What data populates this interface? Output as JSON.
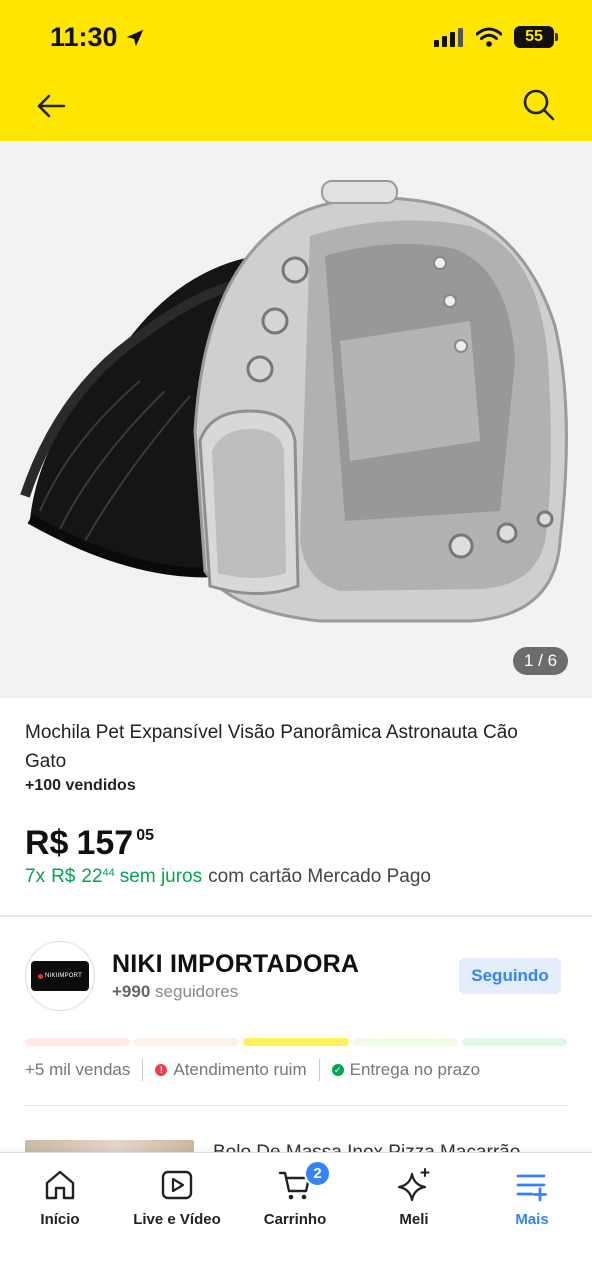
{
  "status_bar": {
    "time": "11:30",
    "battery": "55"
  },
  "gallery": {
    "counter": "1 / 6"
  },
  "product": {
    "title": "Mochila Pet Expansível Visão Panorâmica Astronauta Cão Gato",
    "sold": "+100 vendidos",
    "price_currency": "R$",
    "price_whole": "157",
    "price_cents": "05",
    "installments_count": "7x",
    "installments_currency": "R$",
    "installments_whole": "22",
    "installments_cents": "44",
    "installments_no_interest": "sem juros",
    "installments_suffix": "com cartão Mercado Pago"
  },
  "seller": {
    "name": "NIKI IMPORTADORA",
    "logo_text": "NIKIIMPORT",
    "followers_count": "+990",
    "followers_label": "seguidores",
    "follow_button": "Seguindo",
    "reputation_level": 3,
    "thermometer_colors": [
      "#fdeaea",
      "#fff0e6",
      "#fff159",
      "#f1fbe6",
      "#e3f6ea"
    ],
    "metrics": [
      {
        "label": "+5 mil vendas"
      },
      {
        "label": "Atendimento ruim",
        "icon": "alert-icon",
        "color": "#f23d4f"
      },
      {
        "label": "Entrega no prazo",
        "icon": "check-icon",
        "color": "#00a650"
      }
    ]
  },
  "recommendation": {
    "title": "Bolo De Massa Inox Pizza Macarrão"
  },
  "tab_bar": {
    "items": [
      {
        "label": "Início",
        "icon": "home-icon"
      },
      {
        "label": "Live e Vídeo",
        "icon": "play-icon"
      },
      {
        "label": "Carrinho",
        "icon": "cart-icon",
        "badge": "2"
      },
      {
        "label": "Meli",
        "icon": "sparkle-icon"
      },
      {
        "label": "Mais",
        "icon": "menu-plus-icon",
        "active": true
      }
    ]
  },
  "colors": {
    "brand_yellow": "#ffe600",
    "accent_blue": "#3483fa",
    "green": "#00a650"
  }
}
